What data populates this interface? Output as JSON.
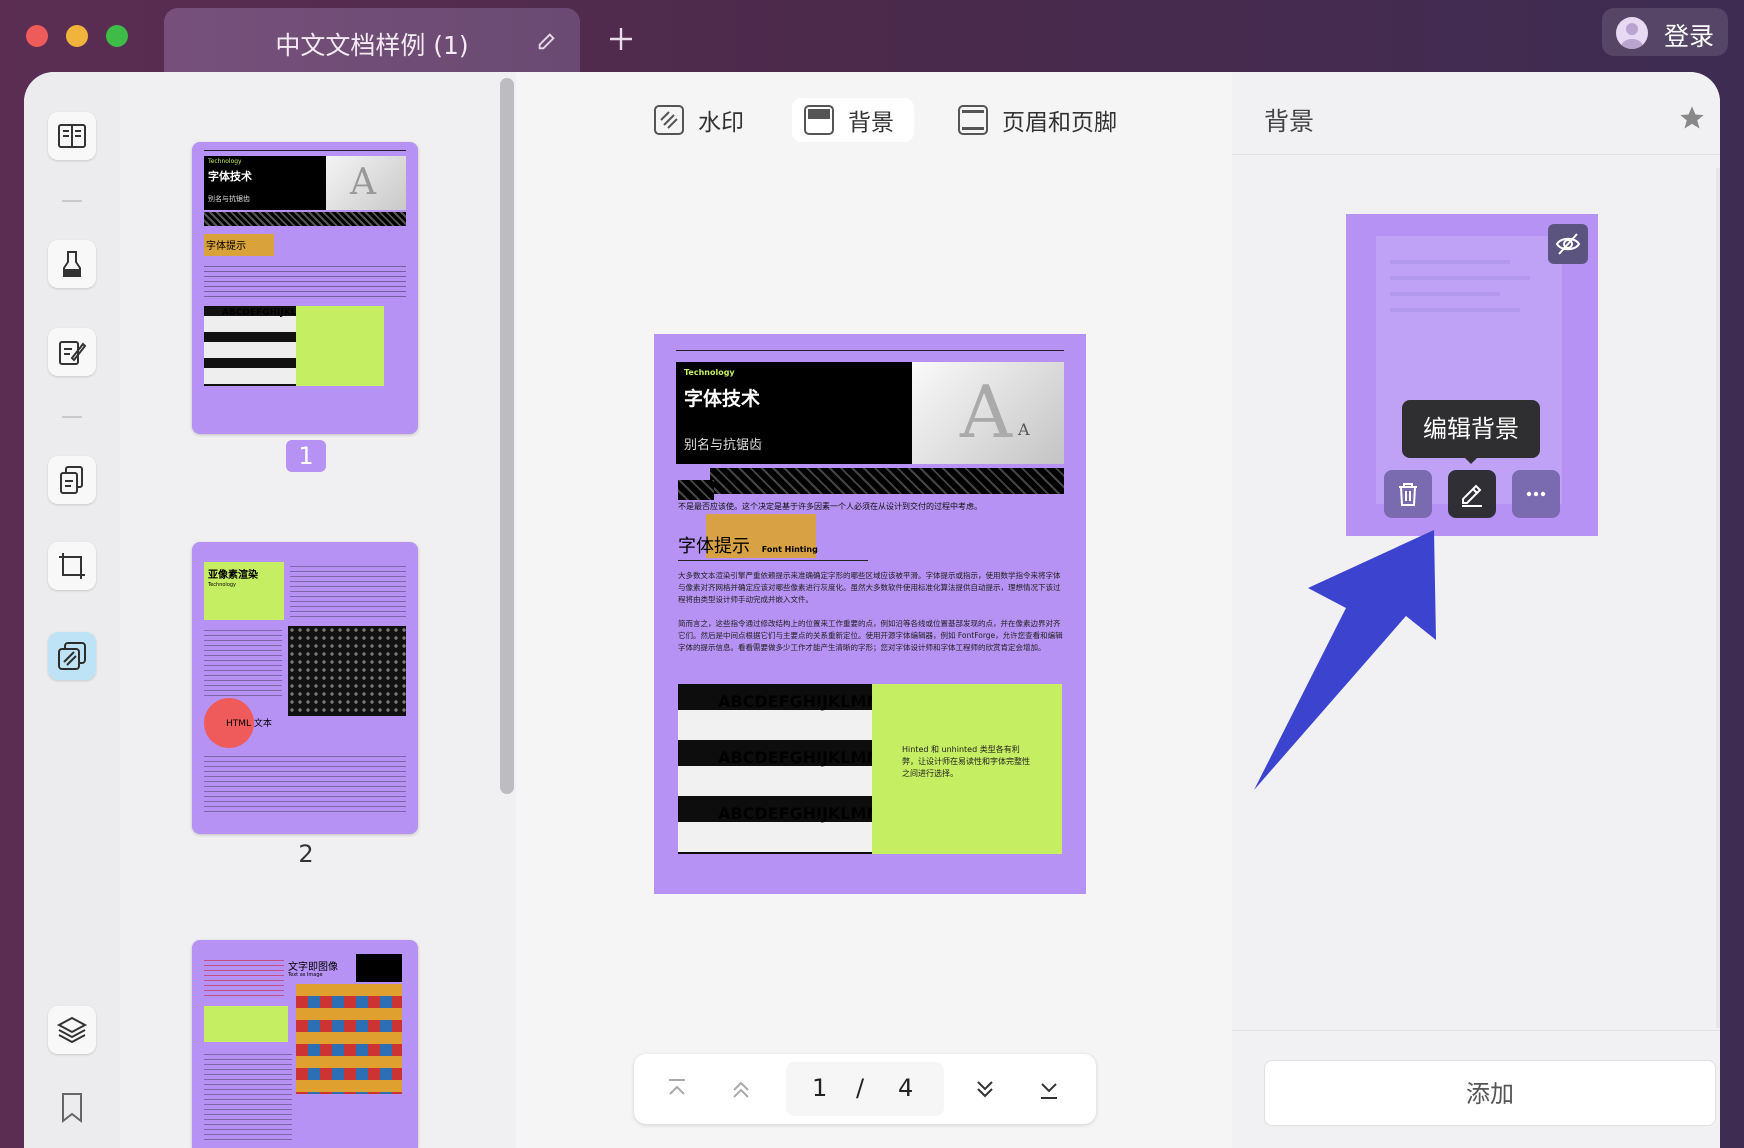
{
  "titlebar": {
    "tab_title": "中文文档样例 (1)",
    "login_label": "登录"
  },
  "thumbnails": {
    "page1_label": "1",
    "page2_label": "2",
    "p1": {
      "kicker": "Technology",
      "title": "字体技术",
      "subtitle": "别名与抗锯齿",
      "hint": "字体提示",
      "hint_en": "Font Hinting",
      "alpha": "ABCDEFGHIJKLMN"
    },
    "p2": {
      "title": "亚像素渲染",
      "kicker": "Technology",
      "circle": "HTML 文本"
    },
    "p3": {
      "title": "文字即图像",
      "kicker": "Text as Image"
    }
  },
  "toolbar": {
    "watermark": "水印",
    "background": "背景",
    "header_footer": "页眉和页脚"
  },
  "page": {
    "kicker": "Technology",
    "title": "字体技术",
    "subtitle": "别名与抗锯齿",
    "hint_title": "字体提示",
    "hint_en": "Font Hinting",
    "lead": "不是最否应该使。这个决定是基于许多因素一个人必须在从设计到交付的过程中考虑。",
    "para1": "大多数文本渲染引擎严重依赖提示来准确确定字形的哪些区域应该被平滑。字体提示或指示，使用数学指令来将字体与像素对齐网格并确定应该对哪些像素进行灰度化。虽然大多数软件使用标准化算法提供自动提示，理想情况下该过程将由类型设计师手动完成并嵌入文件。",
    "para2": "简而言之，这些指令通过修改结构上的位置来工作重要的点，例如沿等各线或位置基部发现的点，并在像素边界对齐它们。然后是中间点根据它们与主要点的关系重新定位。使用开源字体编辑器，例如 FontForge，允许您查看和编辑字体的提示信息。看看需要做多少工作才能产生清晰的字形；您对字体设计师和字体工程师的欣赏肯定会增加。",
    "alphabet": "ABCDEFGHIJKLMNO",
    "note": "Hinted 和 unhinted 类型各有利弊，让设计师在易读性和字体完整性之间进行选择。"
  },
  "pager": {
    "current": "1",
    "separator": "/",
    "total": "4"
  },
  "panel": {
    "title": "背景",
    "tooltip": "编辑背景",
    "add_label": "添加"
  },
  "colors": {
    "accent_purple": "#b592f3",
    "lime": "#c6ee62",
    "arrow_blue": "#3c43cf",
    "highlight_blue": "#bfe3f6"
  }
}
